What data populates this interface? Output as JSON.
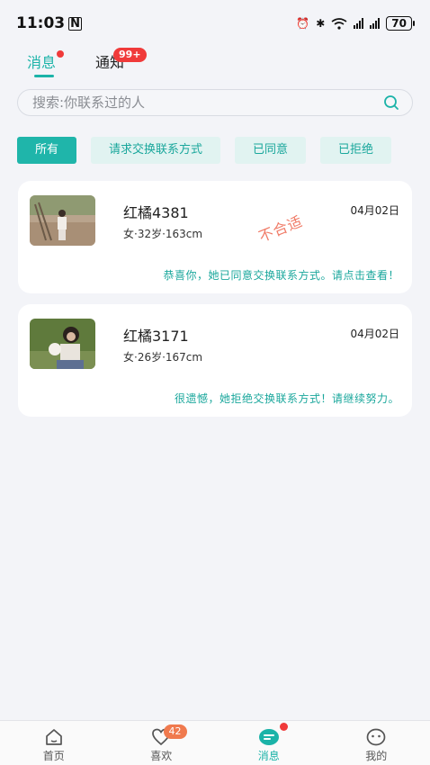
{
  "status_bar": {
    "time": "11:03",
    "battery": "70"
  },
  "top_tabs": [
    {
      "label": "消息"
    },
    {
      "label": "通知",
      "badge": "99+"
    }
  ],
  "search": {
    "placeholder": "搜索:你联系过的人"
  },
  "filters": [
    {
      "label": "所有"
    },
    {
      "label": "请求交换联系方式"
    },
    {
      "label": "已同意"
    },
    {
      "label": "已拒绝"
    }
  ],
  "messages": [
    {
      "name": "红橘4381",
      "info": "女·32岁·163cm",
      "date": "04月02日",
      "stamp": "不合适",
      "message": "恭喜你，她已同意交换联系方式。请点击查看！"
    },
    {
      "name": "红橘3171",
      "info": "女·26岁·167cm",
      "date": "04月02日",
      "message": "很遗憾，她拒绝交换联系方式！请继续努力。"
    }
  ],
  "bottom_nav": [
    {
      "label": "首页"
    },
    {
      "label": "喜欢",
      "badge": "42"
    },
    {
      "label": "消息"
    },
    {
      "label": "我的"
    }
  ],
  "colors": {
    "accent": "#1bb3a8",
    "badge_red": "#f03a3a",
    "stamp": "#f07a66"
  }
}
